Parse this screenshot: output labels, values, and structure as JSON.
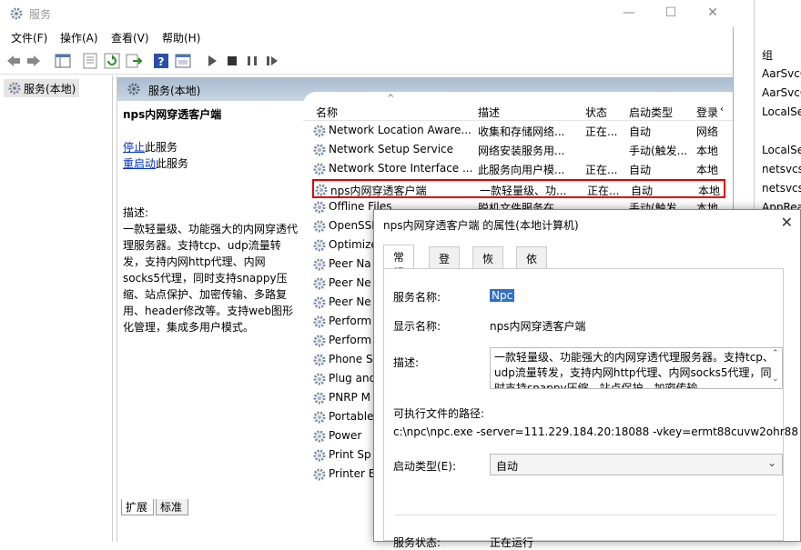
{
  "window": {
    "title": "服务",
    "minimize": "—",
    "maximize": "☐",
    "close": "✕"
  },
  "menu": [
    "文件(F)",
    "操作(A)",
    "查看(V)",
    "帮助(H)"
  ],
  "tree": {
    "item": "服务(本地)"
  },
  "pane": {
    "header": "服务(本地)",
    "selected_title": "nps内网穿透客户端",
    "stop_link": "停止",
    "stop_suffix": "此服务",
    "restart_link": "重启动",
    "restart_suffix": "此服务",
    "desc_label": "描述:",
    "desc_text": "一款轻量级、功能强大的内网穿透代理服务器。支持tcp、udp流量转发，支持内网http代理、内网socks5代理，同时支持snappy压缩、站点保护、加密传输、多路复用、header修改等。支持web图形化管理，集成多用户模式。"
  },
  "list": {
    "headers": {
      "name": "名称",
      "desc": "描述",
      "status": "状态",
      "startup": "启动类型",
      "logon": "登录"
    },
    "rows": [
      {
        "name": "Network Location Aware...",
        "desc": "收集和存储网络...",
        "status": "正在...",
        "startup": "自动",
        "logon": "网络"
      },
      {
        "name": "Network Setup Service",
        "desc": "网络安装服务用...",
        "status": "",
        "startup": "手动(触发...",
        "logon": "本地"
      },
      {
        "name": "Network Store Interface ...",
        "desc": "此服务向用户模...",
        "status": "正在...",
        "startup": "自动",
        "logon": "本地"
      },
      {
        "name": "nps内网穿透客户端",
        "desc": "一款轻量级、功...",
        "status": "正在...",
        "startup": "自动",
        "logon": "本地"
      },
      {
        "name": "Offline Files",
        "desc": "脱机文件服务在...",
        "status": "",
        "startup": "手动(触发...",
        "logon": "本地"
      },
      {
        "name": "OpenSSH",
        "desc": "",
        "status": "",
        "startup": "",
        "logon": ""
      },
      {
        "name": "Optimize",
        "desc": "",
        "status": "",
        "startup": "",
        "logon": ""
      },
      {
        "name": "Peer Na",
        "desc": "",
        "status": "",
        "startup": "",
        "logon": ""
      },
      {
        "name": "Peer Ne",
        "desc": "",
        "status": "",
        "startup": "",
        "logon": ""
      },
      {
        "name": "Peer Ne",
        "desc": "",
        "status": "",
        "startup": "",
        "logon": ""
      },
      {
        "name": "Perform",
        "desc": "",
        "status": "",
        "startup": "",
        "logon": ""
      },
      {
        "name": "Perform",
        "desc": "",
        "status": "",
        "startup": "",
        "logon": ""
      },
      {
        "name": "Phone S",
        "desc": "",
        "status": "",
        "startup": "",
        "logon": ""
      },
      {
        "name": "Plug and",
        "desc": "",
        "status": "",
        "startup": "",
        "logon": ""
      },
      {
        "name": "PNRP M",
        "desc": "",
        "status": "",
        "startup": "",
        "logon": ""
      },
      {
        "name": "Portable",
        "desc": "",
        "status": "",
        "startup": "",
        "logon": ""
      },
      {
        "name": "Power",
        "desc": "",
        "status": "",
        "startup": "",
        "logon": ""
      },
      {
        "name": "Print Sp",
        "desc": "",
        "status": "",
        "startup": "",
        "logon": ""
      },
      {
        "name": "Printer E",
        "desc": "",
        "status": "",
        "startup": "",
        "logon": ""
      }
    ]
  },
  "bottom_tabs": [
    "扩展",
    "标准"
  ],
  "right_column": [
    "组",
    "AarSvcG",
    "AarSvcG",
    "LocalSe",
    "",
    "LocalSe",
    "netsvcs",
    "netsvcs",
    "AppRea"
  ],
  "dialog": {
    "title": "nps内网穿透客户端 的属性(本地计算机)",
    "close": "✕",
    "tabs": [
      "常规",
      "登录",
      "恢复",
      "依存关系"
    ],
    "service_name_label": "服务名称:",
    "service_name_value": "Npc",
    "display_name_label": "显示名称:",
    "display_name_value": "nps内网穿透客户端",
    "desc_label": "描述:",
    "desc_value": "一款轻量级、功能强大的内网穿透代理服务器。支持tcp、udp流量转发，支持内网http代理、内网socks5代理，同时支持snappy压缩、站点保护、加密传输",
    "exe_label": "可执行文件的路径:",
    "exe_value": "c:\\npc\\npc.exe -server=111.229.184.20:18088 -vkey=ermt88cuvw2ohr88",
    "startup_label": "启动类型(E):",
    "startup_value": "自动",
    "status_label": "服务状态:",
    "status_value": "正在运行"
  }
}
